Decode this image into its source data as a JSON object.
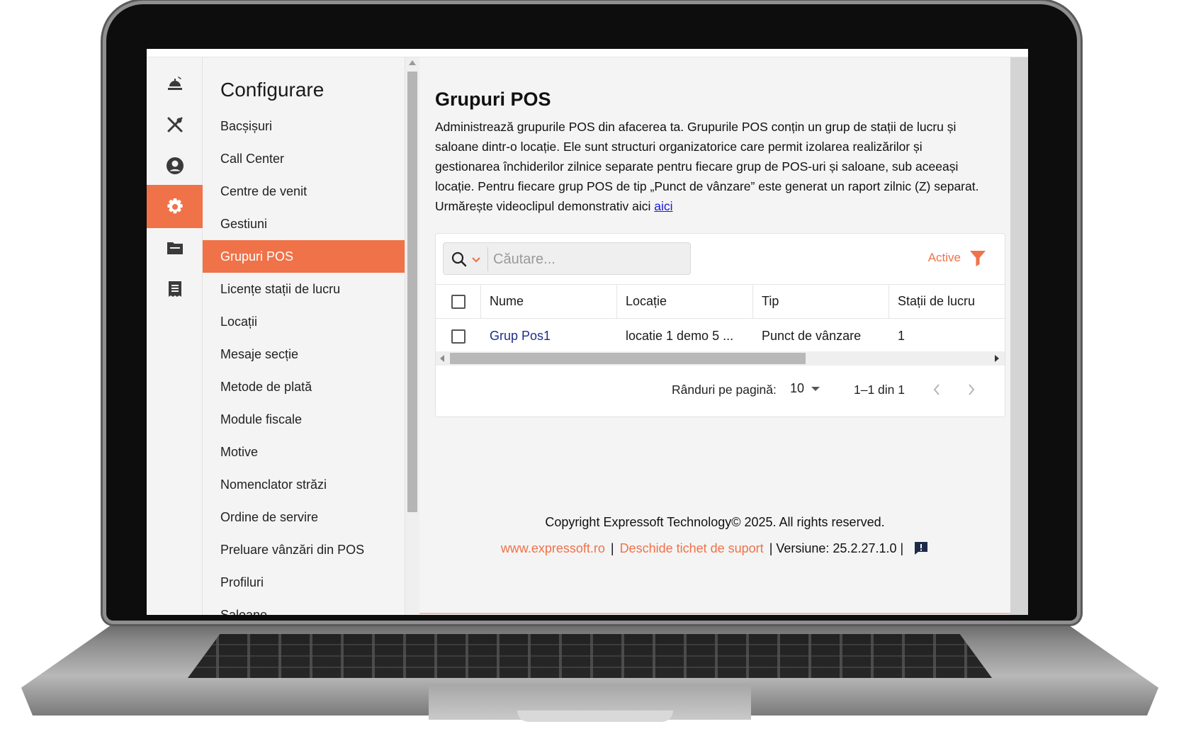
{
  "rail": {
    "items": [
      {
        "icon": "dish-icon"
      },
      {
        "icon": "utensils-icon"
      },
      {
        "icon": "user-circle-icon"
      },
      {
        "icon": "gear-icon",
        "active": true
      },
      {
        "icon": "folder-icon"
      },
      {
        "icon": "receipt-icon"
      }
    ]
  },
  "menu": {
    "title": "Configurare",
    "items": [
      "Bacșișuri",
      "Call Center",
      "Centre de venit",
      "Gestiuni",
      "Grupuri POS",
      "Licențe stații de lucru",
      "Locații",
      "Mesaje secție",
      "Metode de plată",
      "Module fiscale",
      "Motive",
      "Nomenclator străzi",
      "Ordine de servire",
      "Preluare vânzări din POS",
      "Profiluri",
      "Saloane"
    ],
    "active_index": 4
  },
  "page": {
    "title": "Grupuri POS",
    "description": "Administrează grupurile POS din afacerea ta. Grupurile POS conțin un grup de stații de lucru și saloane dintr-o locație. Ele sunt structuri organizatorice care permit izolarea realizărilor și gestionarea închiderilor zilnice separate pentru fiecare grup de POS-uri și saloane, sub aceeași locație. Pentru fiecare grup POS de tip „Punct de vânzare” este generat un raport zilnic (Z) separat. Urmărește videoclipul demonstrativ aici",
    "link_text": "aici"
  },
  "search": {
    "placeholder": "Căutare...",
    "value": ""
  },
  "filter": {
    "label": "Active"
  },
  "table": {
    "columns": [
      "Nume",
      "Locație",
      "Tip",
      "Stații de lucru"
    ],
    "rows": [
      {
        "name": "Grup Pos1",
        "location": "locatie 1 demo 5 ...",
        "type": "Punct de vânzare",
        "stations": "1"
      }
    ]
  },
  "pagination": {
    "rows_per_page_label": "Rânduri pe pagină:",
    "rows_per_page": "10",
    "range": "1–1 din 1"
  },
  "footer": {
    "copyright": "Copyright Expressoft Technology© 2025. All rights reserved.",
    "website": "www.expressoft.ro",
    "separator": "|",
    "support": "Deschide tichet de suport",
    "version": "| Versiune: 25.2.27.1.0 |"
  },
  "colors": {
    "accent": "#f07249",
    "link": "#1f2f87",
    "background": "#f4f4f4"
  }
}
